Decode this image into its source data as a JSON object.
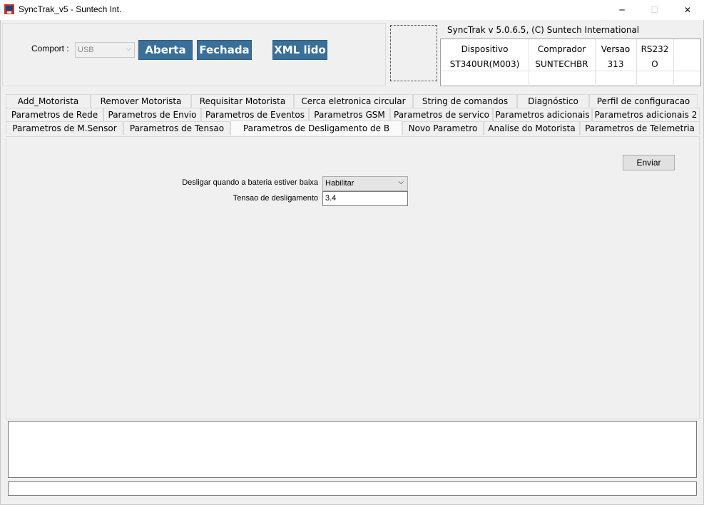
{
  "window": {
    "title": "SyncTrak_v5 - Suntech Int.",
    "minimize": "─",
    "maximize": "☐",
    "close": "✕"
  },
  "connection": {
    "comport_label": "Comport :",
    "comport_value": "USB",
    "open_label": "Aberta",
    "close_label": "Fechada",
    "xml_label": "XML lido"
  },
  "info": {
    "title": "SyncTrak v 5.0.6.5, (C) Suntech International",
    "headers": [
      "Dispositivo",
      "Comprador",
      "Versao",
      "RS232"
    ],
    "values": [
      "ST340UR(M003)",
      "SUNTECHBR",
      "313",
      "O"
    ]
  },
  "tabs": {
    "row1": [
      "Add_Motorista",
      "Remover Motorista",
      "Requisitar Motorista",
      "Cerca eletronica circular",
      "String de comandos",
      "Diagnóstico",
      "Perfil de configuracao"
    ],
    "row2": [
      "Parametros de Rede",
      "Parametros de Envio",
      "Parametros de Eventos",
      "Parametros GSM",
      "Parametros de servico",
      "Parametros adicionais",
      "Parametros adicionais 2"
    ],
    "row3": [
      "Parametros  de M.Sensor",
      "Parametros de Tensao",
      "Parametros de Desligamento de B",
      "Novo Parametro",
      "Analise do Motorista",
      "Parametros de Telemetria"
    ],
    "active": "Parametros de Desligamento de B"
  },
  "form": {
    "send_label": "Enviar",
    "battery_label": "Desligar quando a bateria estiver baixa",
    "battery_value": "Habilitar",
    "voltage_label": "Tensao de desligamento",
    "voltage_value": "3.4"
  },
  "colors": {
    "accent_button": "#3a6f9a",
    "background": "#f0f0f0"
  }
}
